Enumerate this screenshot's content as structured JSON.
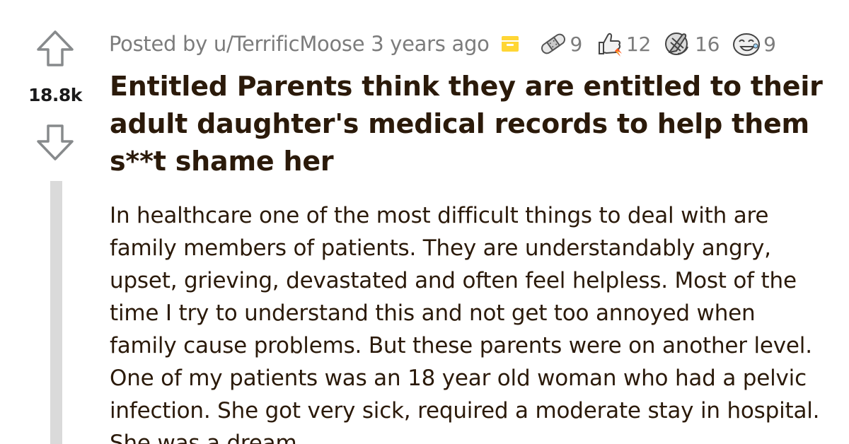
{
  "post": {
    "score": "18.8k",
    "posted_by": "Posted by u/TerrificMoose 3 years ago",
    "awards": [
      {
        "icon": "bandaid-award-icon",
        "count": "9"
      },
      {
        "icon": "thumbs-up-rocket-award-icon",
        "count": "12"
      },
      {
        "icon": "facepalm-award-icon",
        "count": "16"
      },
      {
        "icon": "laughing-face-award-icon",
        "count": "9"
      }
    ],
    "title": "Entitled Parents think they are entitled to their adult daughter's medical records to help them s**t shame her",
    "body": "In healthcare one of the most difficult things to deal with are family members of patients. They are understandably angry, upset, grieving, devastated and often feel helpless. Most of the time I try to understand this and not get too annoyed when family cause problems. But these parents were on another level. One of my patients was an 18 year old woman who had a pelvic infection. She got very sick, required a moderate stay in hospital. She was a dream"
  },
  "colors": {
    "meta_gray": "#7c7c7c",
    "text": "#2b1a0a",
    "archive_yellow": "#ffd635",
    "thread_line": "#dadada"
  }
}
